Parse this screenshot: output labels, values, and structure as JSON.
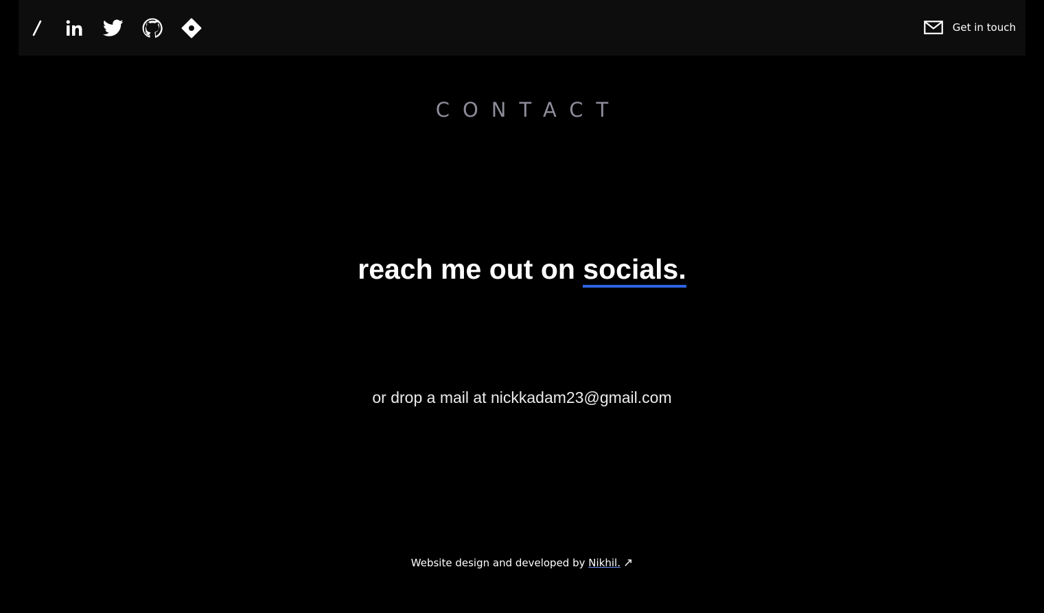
{
  "nav": {
    "social_icons": [
      "slash-icon",
      "linkedin-icon",
      "twitter-icon",
      "github-icon",
      "portfolio-icon"
    ],
    "get_in_touch_label": "Get in touch",
    "get_in_touch_icon": "mail-icon"
  },
  "section": {
    "heading": "CONTACT"
  },
  "main": {
    "headline_prefix": "reach me out on ",
    "headline_link": "socials.",
    "mail_line": "or drop a mail at nickkadam23@gmail.com"
  },
  "footer": {
    "text": "Website design and developed by ",
    "author": "Nikhil.",
    "arrow": "↗"
  },
  "colors": {
    "background": "#000000",
    "topbar": "#0d0d0d",
    "heading": "#8d8d9a",
    "accent_underline": "#2f63e6"
  }
}
